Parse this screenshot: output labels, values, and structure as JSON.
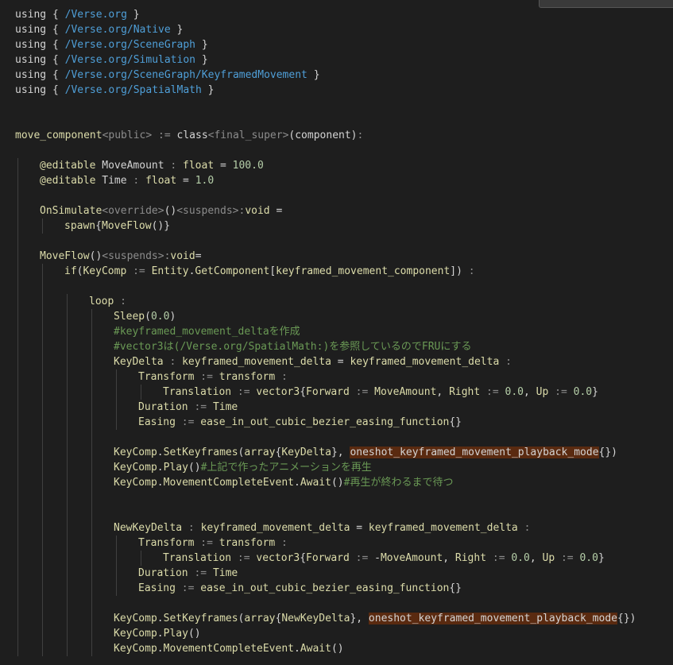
{
  "code": {
    "lines": [
      {
        "indent": 0,
        "tokens": [
          [
            "kw",
            "using { "
          ],
          [
            "str",
            "/Verse.org"
          ],
          [
            "kw",
            " }"
          ]
        ]
      },
      {
        "indent": 0,
        "tokens": [
          [
            "kw",
            "using { "
          ],
          [
            "str",
            "/Verse.org/Native"
          ],
          [
            "kw",
            " }"
          ]
        ]
      },
      {
        "indent": 0,
        "tokens": [
          [
            "kw",
            "using { "
          ],
          [
            "str",
            "/Verse.org/SceneGraph"
          ],
          [
            "kw",
            " }"
          ]
        ]
      },
      {
        "indent": 0,
        "tokens": [
          [
            "kw",
            "using { "
          ],
          [
            "str",
            "/Verse.org/Simulation"
          ],
          [
            "kw",
            " }"
          ]
        ]
      },
      {
        "indent": 0,
        "tokens": [
          [
            "kw",
            "using { "
          ],
          [
            "str",
            "/Verse.org/SceneGraph/KeyframedMovement"
          ],
          [
            "kw",
            " }"
          ]
        ]
      },
      {
        "indent": 0,
        "tokens": [
          [
            "kw",
            "using { "
          ],
          [
            "str",
            "/Verse.org/SpatialMath"
          ],
          [
            "kw",
            " }"
          ]
        ]
      },
      {
        "indent": 0,
        "tokens": []
      },
      {
        "indent": 0,
        "tokens": []
      },
      {
        "indent": 0,
        "tokens": [
          [
            "type",
            "move_component"
          ],
          [
            "spec",
            "<public>"
          ],
          [
            "spec",
            " := "
          ],
          [
            "plain",
            "class"
          ],
          [
            "spec",
            "<final_super>"
          ],
          [
            "plain",
            "(component)"
          ],
          [
            "spec",
            ":"
          ]
        ]
      },
      {
        "indent": 0,
        "tokens": []
      },
      {
        "indent": 1,
        "tokens": [
          [
            "type",
            "@editable"
          ],
          [
            "plain",
            " MoveAmount "
          ],
          [
            "spec",
            ": "
          ],
          [
            "type",
            "float"
          ],
          [
            "plain",
            " = "
          ],
          [
            "num",
            "100.0"
          ]
        ]
      },
      {
        "indent": 1,
        "tokens": [
          [
            "type",
            "@editable"
          ],
          [
            "plain",
            " Time "
          ],
          [
            "spec",
            ": "
          ],
          [
            "type",
            "float"
          ],
          [
            "plain",
            " = "
          ],
          [
            "num",
            "1.0"
          ]
        ]
      },
      {
        "indent": 0,
        "tokens": []
      },
      {
        "indent": 1,
        "tokens": [
          [
            "type",
            "OnSimulate"
          ],
          [
            "spec",
            "<override>"
          ],
          [
            "plain",
            "()"
          ],
          [
            "spec",
            "<suspends>"
          ],
          [
            "spec",
            ":"
          ],
          [
            "type",
            "void"
          ],
          [
            "plain",
            " ="
          ]
        ]
      },
      {
        "indent": 2,
        "tokens": [
          [
            "type",
            "spawn"
          ],
          [
            "plain",
            "{"
          ],
          [
            "type",
            "MoveFlow"
          ],
          [
            "plain",
            "()}"
          ]
        ]
      },
      {
        "indent": 0,
        "tokens": []
      },
      {
        "indent": 1,
        "tokens": [
          [
            "type",
            "MoveFlow"
          ],
          [
            "plain",
            "()"
          ],
          [
            "spec",
            "<suspends>"
          ],
          [
            "spec",
            ":"
          ],
          [
            "type",
            "void"
          ],
          [
            "plain",
            "="
          ]
        ]
      },
      {
        "indent": 2,
        "tokens": [
          [
            "type",
            "if"
          ],
          [
            "plain",
            "("
          ],
          [
            "type",
            "KeyComp"
          ],
          [
            "spec",
            " := "
          ],
          [
            "type",
            "Entity"
          ],
          [
            "plain",
            "."
          ],
          [
            "type",
            "GetComponent"
          ],
          [
            "plain",
            "["
          ],
          [
            "type",
            "keyframed_movement_component"
          ],
          [
            "plain",
            "]) "
          ],
          [
            "spec",
            ":"
          ]
        ]
      },
      {
        "indent": 0,
        "tokens": []
      },
      {
        "indent": 3,
        "tokens": [
          [
            "type",
            "loop"
          ],
          [
            "spec",
            " :"
          ]
        ]
      },
      {
        "indent": 4,
        "tokens": [
          [
            "type",
            "Sleep"
          ],
          [
            "plain",
            "("
          ],
          [
            "num",
            "0.0"
          ],
          [
            "plain",
            ")"
          ]
        ]
      },
      {
        "indent": 4,
        "tokens": [
          [
            "com",
            "#keyframed_movement_deltaを作成"
          ]
        ]
      },
      {
        "indent": 4,
        "tokens": [
          [
            "com",
            "#vector3は(/Verse.org/SpatialMath:)を参照しているのでFRUにする"
          ]
        ]
      },
      {
        "indent": 4,
        "tokens": [
          [
            "type",
            "KeyDelta"
          ],
          [
            "spec",
            " : "
          ],
          [
            "type",
            "keyframed_movement_delta"
          ],
          [
            "plain",
            " = "
          ],
          [
            "type",
            "keyframed_movement_delta"
          ],
          [
            "spec",
            " :"
          ]
        ]
      },
      {
        "indent": 5,
        "tokens": [
          [
            "type",
            "Transform"
          ],
          [
            "spec",
            " := "
          ],
          [
            "type",
            "transform"
          ],
          [
            "spec",
            " :"
          ]
        ]
      },
      {
        "indent": 6,
        "tokens": [
          [
            "type",
            "Translation"
          ],
          [
            "spec",
            " := "
          ],
          [
            "type",
            "vector3"
          ],
          [
            "plain",
            "{"
          ],
          [
            "type",
            "Forward"
          ],
          [
            "spec",
            " := "
          ],
          [
            "type",
            "MoveAmount"
          ],
          [
            "plain",
            ", "
          ],
          [
            "type",
            "Right"
          ],
          [
            "spec",
            " := "
          ],
          [
            "num",
            "0.0"
          ],
          [
            "plain",
            ", "
          ],
          [
            "type",
            "Up"
          ],
          [
            "spec",
            " := "
          ],
          [
            "num",
            "0.0"
          ],
          [
            "plain",
            "}"
          ]
        ]
      },
      {
        "indent": 5,
        "tokens": [
          [
            "type",
            "Duration"
          ],
          [
            "spec",
            " := "
          ],
          [
            "type",
            "Time"
          ]
        ]
      },
      {
        "indent": 5,
        "tokens": [
          [
            "type",
            "Easing"
          ],
          [
            "spec",
            " := "
          ],
          [
            "type",
            "ease_in_out_cubic_bezier_easing_function"
          ],
          [
            "plain",
            "{}"
          ]
        ]
      },
      {
        "indent": 0,
        "tokens": []
      },
      {
        "indent": 4,
        "tokens": [
          [
            "type",
            "KeyComp"
          ],
          [
            "plain",
            "."
          ],
          [
            "type",
            "SetKeyframes"
          ],
          [
            "plain",
            "("
          ],
          [
            "type",
            "array"
          ],
          [
            "plain",
            "{"
          ],
          [
            "type",
            "KeyDelta"
          ],
          [
            "plain",
            "}, "
          ],
          [
            "hl",
            "oneshot_keyframed_movement_playback_mode"
          ],
          [
            "plain",
            "{})"
          ]
        ]
      },
      {
        "indent": 4,
        "tokens": [
          [
            "type",
            "KeyComp"
          ],
          [
            "plain",
            "."
          ],
          [
            "type",
            "Play"
          ],
          [
            "plain",
            "()"
          ],
          [
            "com",
            "#上記で作ったアニメーションを再生"
          ]
        ]
      },
      {
        "indent": 4,
        "tokens": [
          [
            "type",
            "KeyComp"
          ],
          [
            "plain",
            "."
          ],
          [
            "type",
            "MovementCompleteEvent"
          ],
          [
            "plain",
            "."
          ],
          [
            "type",
            "Await"
          ],
          [
            "plain",
            "()"
          ],
          [
            "com",
            "#再生が終わるまで待つ"
          ]
        ]
      },
      {
        "indent": 0,
        "tokens": []
      },
      {
        "indent": 0,
        "tokens": []
      },
      {
        "indent": 4,
        "tokens": [
          [
            "type",
            "NewKeyDelta"
          ],
          [
            "spec",
            " : "
          ],
          [
            "type",
            "keyframed_movement_delta"
          ],
          [
            "plain",
            " = "
          ],
          [
            "type",
            "keyframed_movement_delta"
          ],
          [
            "spec",
            " :"
          ]
        ]
      },
      {
        "indent": 5,
        "tokens": [
          [
            "type",
            "Transform"
          ],
          [
            "spec",
            " := "
          ],
          [
            "type",
            "transform"
          ],
          [
            "spec",
            " :"
          ]
        ]
      },
      {
        "indent": 6,
        "tokens": [
          [
            "type",
            "Translation"
          ],
          [
            "spec",
            " := "
          ],
          [
            "type",
            "vector3"
          ],
          [
            "plain",
            "{"
          ],
          [
            "type",
            "Forward"
          ],
          [
            "spec",
            " := "
          ],
          [
            "plain",
            "-"
          ],
          [
            "type",
            "MoveAmount"
          ],
          [
            "plain",
            ", "
          ],
          [
            "type",
            "Right"
          ],
          [
            "spec",
            " := "
          ],
          [
            "num",
            "0.0"
          ],
          [
            "plain",
            ", "
          ],
          [
            "type",
            "Up"
          ],
          [
            "spec",
            " := "
          ],
          [
            "num",
            "0.0"
          ],
          [
            "plain",
            "}"
          ]
        ]
      },
      {
        "indent": 5,
        "tokens": [
          [
            "type",
            "Duration"
          ],
          [
            "spec",
            " := "
          ],
          [
            "type",
            "Time"
          ]
        ]
      },
      {
        "indent": 5,
        "tokens": [
          [
            "type",
            "Easing"
          ],
          [
            "spec",
            " := "
          ],
          [
            "type",
            "ease_in_out_cubic_bezier_easing_function"
          ],
          [
            "plain",
            "{}"
          ]
        ]
      },
      {
        "indent": 0,
        "tokens": []
      },
      {
        "indent": 4,
        "tokens": [
          [
            "type",
            "KeyComp"
          ],
          [
            "plain",
            "."
          ],
          [
            "type",
            "SetKeyframes"
          ],
          [
            "plain",
            "("
          ],
          [
            "type",
            "array"
          ],
          [
            "plain",
            "{"
          ],
          [
            "type",
            "NewKeyDelta"
          ],
          [
            "plain",
            "}, "
          ],
          [
            "hl",
            "oneshot_keyframed_movement_playback_mode"
          ],
          [
            "plain",
            "{})"
          ]
        ]
      },
      {
        "indent": 4,
        "tokens": [
          [
            "type",
            "KeyComp"
          ],
          [
            "plain",
            "."
          ],
          [
            "type",
            "Play"
          ],
          [
            "plain",
            "()"
          ]
        ]
      },
      {
        "indent": 4,
        "tokens": [
          [
            "type",
            "KeyComp"
          ],
          [
            "plain",
            "."
          ],
          [
            "type",
            "MovementCompleteEvent"
          ],
          [
            "plain",
            "."
          ],
          [
            "type",
            "Await"
          ],
          [
            "plain",
            "()"
          ]
        ]
      }
    ]
  }
}
